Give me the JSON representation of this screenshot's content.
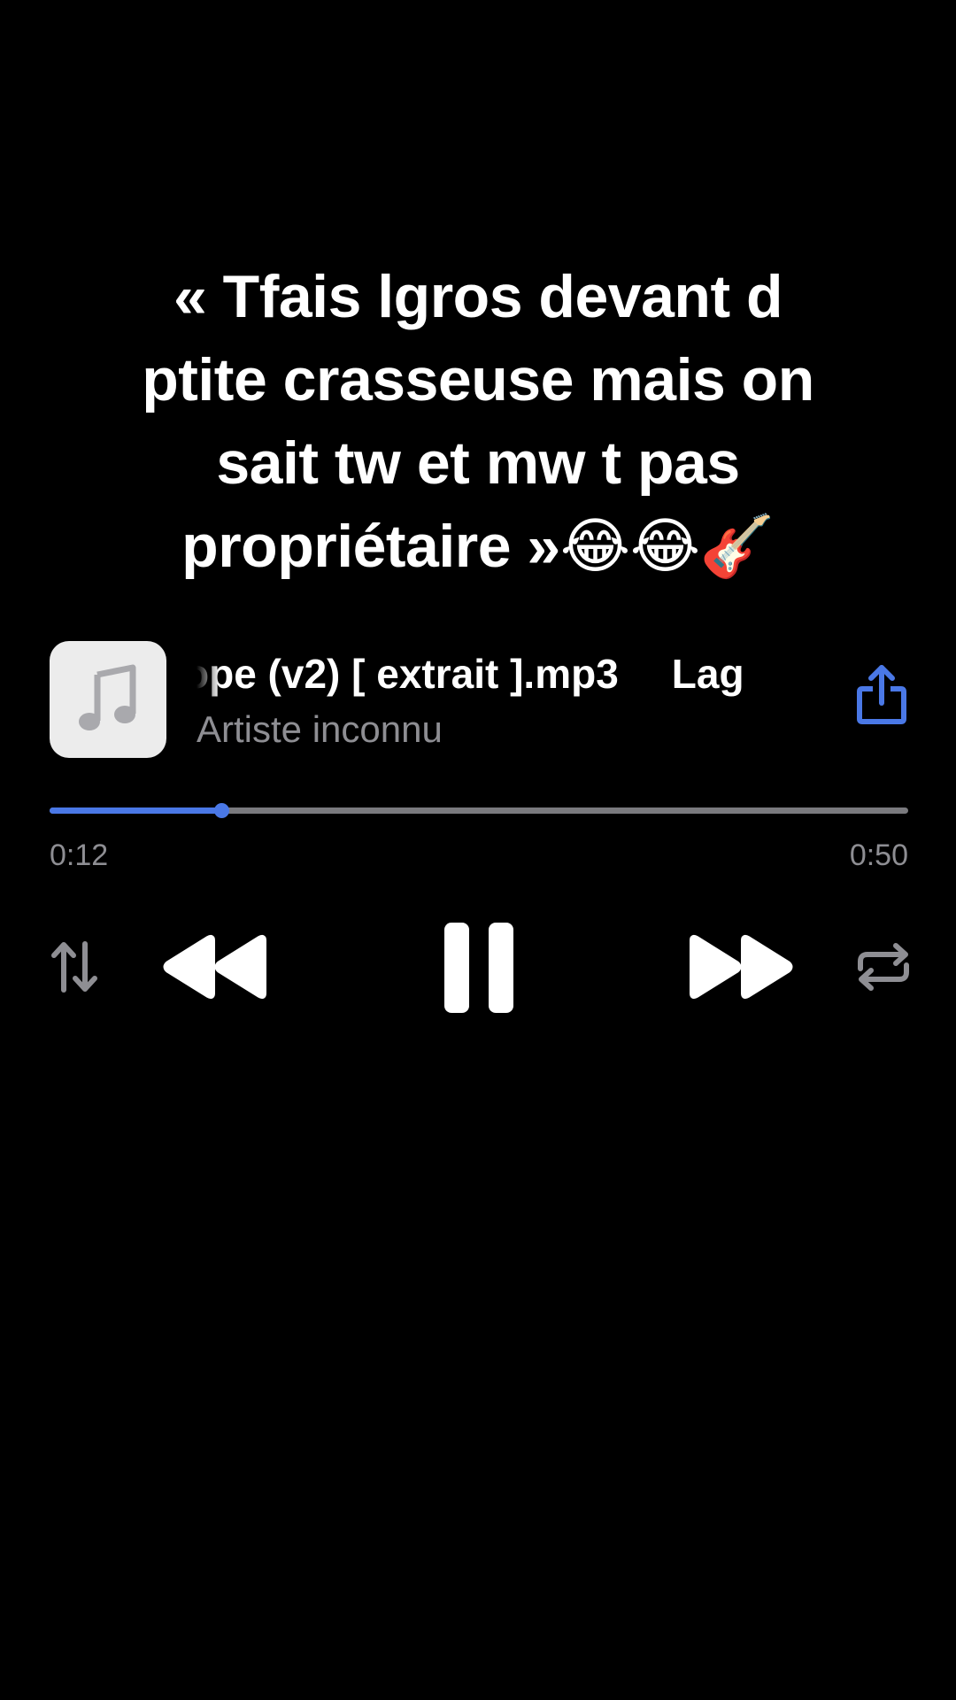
{
  "caption": "« Tfais lgros devant d\nptite crasseuse mais on\nsait tw et mw t pas\npropriétaire »😂😂🎸",
  "player": {
    "title_visible": "ope (v2) [ extrait ].mp3",
    "title_next": "Lag",
    "artist": "Artiste inconnu",
    "elapsed": "0:12",
    "total": "0:50",
    "progress": 0.2,
    "accent_color": "#4a78e6"
  },
  "icons": {
    "artwork": "music-note-icon",
    "share": "share-icon",
    "shuffle": "sort-arrows-icon",
    "previous": "rewind-icon",
    "play_pause": "pause-icon",
    "next": "fast-forward-icon",
    "repeat": "repeat-icon"
  }
}
